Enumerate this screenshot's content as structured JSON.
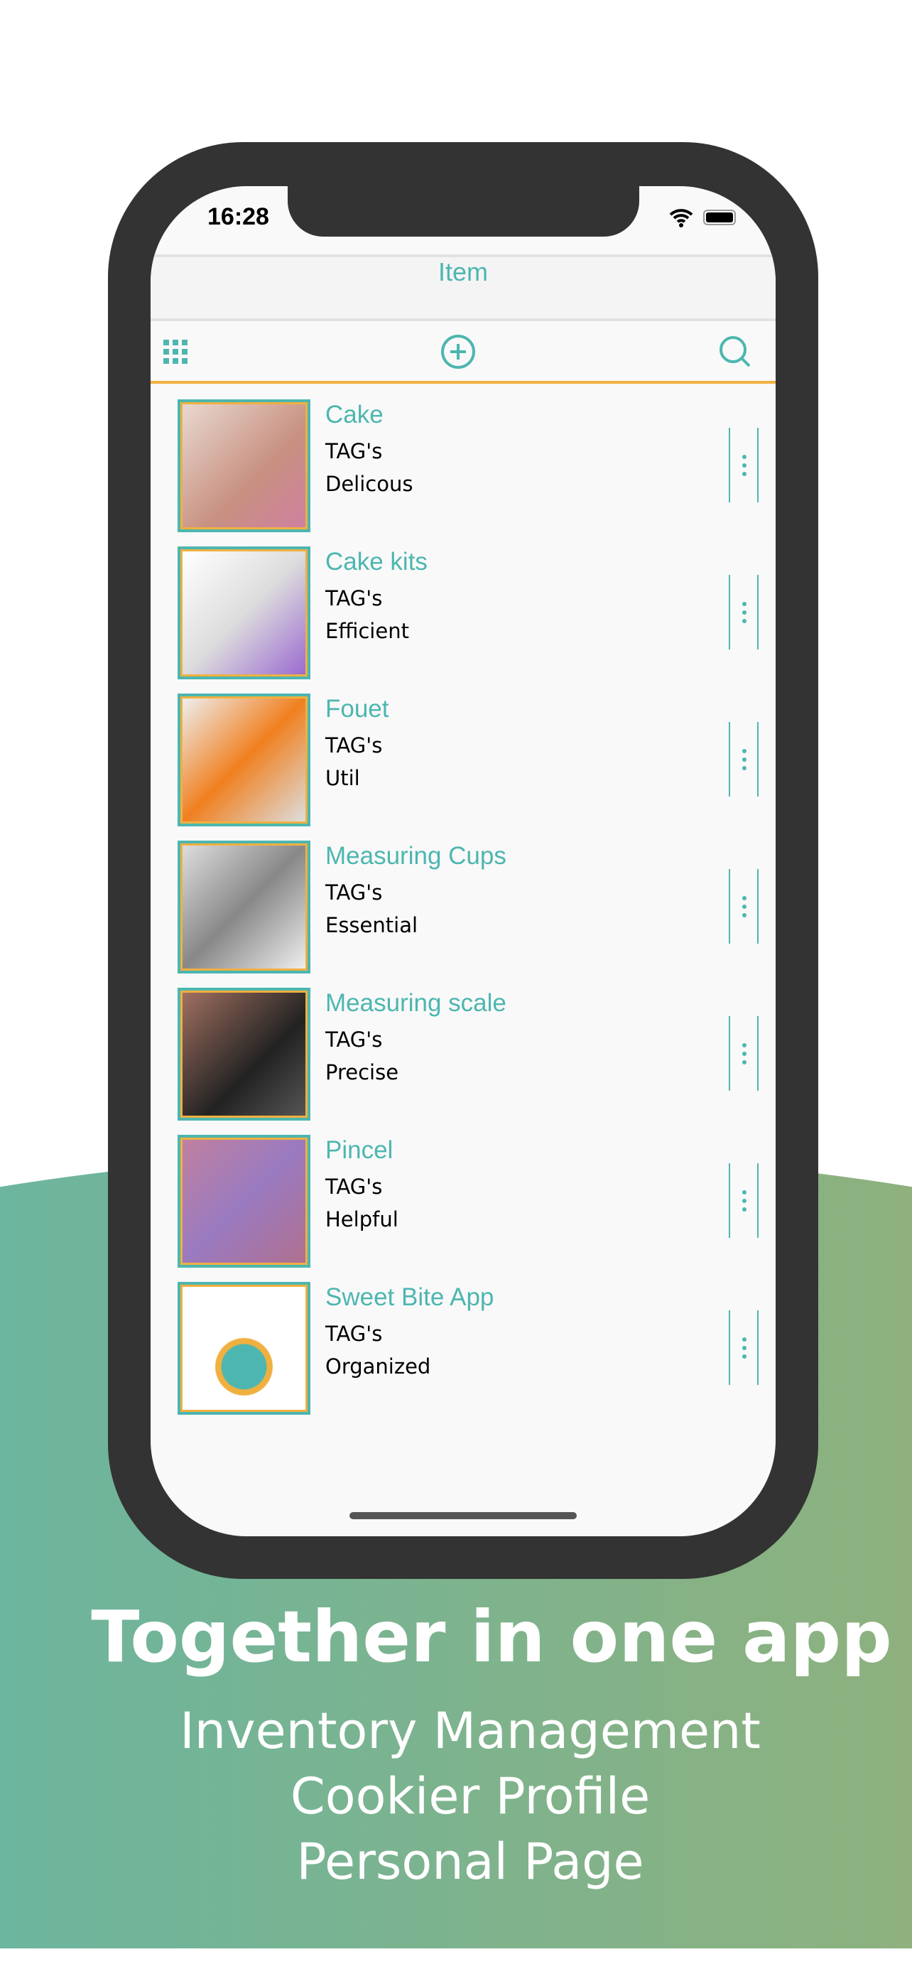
{
  "status": {
    "time": "16:28"
  },
  "navbar": {
    "title": "Item"
  },
  "toolbar": {
    "left_icon": "grid-icon",
    "center_icon": "add-circle-icon",
    "right_icon": "search-icon"
  },
  "colors": {
    "accent": "#4db6b0",
    "divider": "#f0b040",
    "frame": "#333333",
    "gradient_start": "#6cb59e",
    "gradient_end": "#8eb17e"
  },
  "items": [
    {
      "title": "Cake",
      "tag": "TAG's",
      "desc": "Delicous"
    },
    {
      "title": "Cake kits",
      "tag": "TAG's",
      "desc": "Efficient"
    },
    {
      "title": "Fouet",
      "tag": "TAG's",
      "desc": "Util"
    },
    {
      "title": "Measuring Cups",
      "tag": "TAG's",
      "desc": "Essential"
    },
    {
      "title": "Measuring scale",
      "tag": "TAG's",
      "desc": "Precise"
    },
    {
      "title": "Pincel",
      "tag": "TAG's",
      "desc": "Helpful"
    },
    {
      "title": "Sweet Bite App",
      "tag": "TAG's",
      "desc": "Organized"
    }
  ],
  "promo": {
    "headline": "Together in one app",
    "lines": [
      "Inventory Management",
      "Cookier Profile",
      "Personal Page"
    ]
  }
}
